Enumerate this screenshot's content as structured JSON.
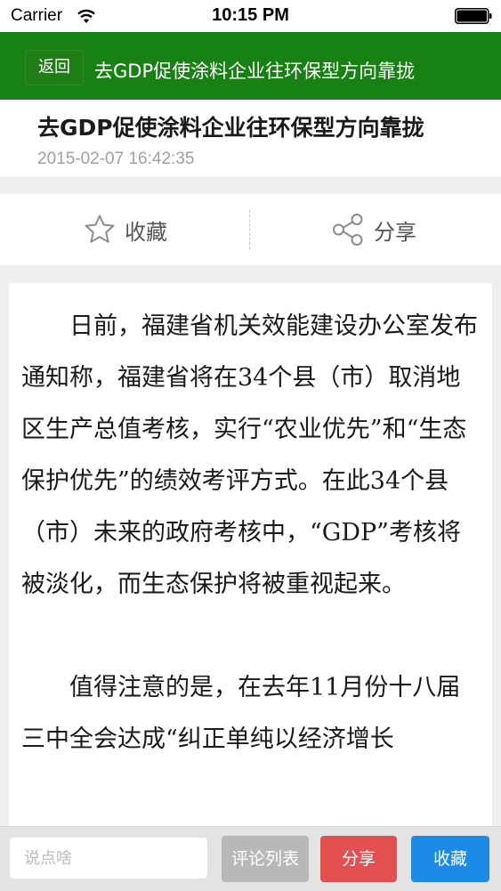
{
  "status_bar": {
    "carrier": "Carrier",
    "time": "10:15 PM"
  },
  "nav": {
    "back_label": "返回",
    "title": "去GDP促使涂料企业往环保型方向靠拢",
    "bar_color": "#178113"
  },
  "article": {
    "title": "去GDP促使涂料企业往环保型方向靠拢",
    "date": "2015-02-07 16:42:35",
    "paragraphs": [
      "日前，福建省机关效能建设办公室发布通知称，福建省将在34个县（市）取消地区生产总值考核，实行“农业优先”和“生态保护优先”的绩效考评方式。在此34个县（市）未来的政府考核中，“GDP”考核将被淡化，而生态保护将被重视起来。",
      "值得注意的是，在去年11月份十八届三中全会达成“纠正单纯以经济增长"
    ]
  },
  "actions": {
    "favorite_label": "收藏",
    "favorite_icon": "star-outline-icon",
    "share_label": "分享",
    "share_icon": "share-nodes-icon"
  },
  "bottom_bar": {
    "comment_placeholder": "说点啥",
    "comments_list_label": "评论列表",
    "share_label": "分享",
    "favorite_label": "收藏",
    "colors": {
      "comments_list": "#b8b8b8",
      "share": "#e2504f",
      "favorite": "#1c8be8"
    }
  }
}
